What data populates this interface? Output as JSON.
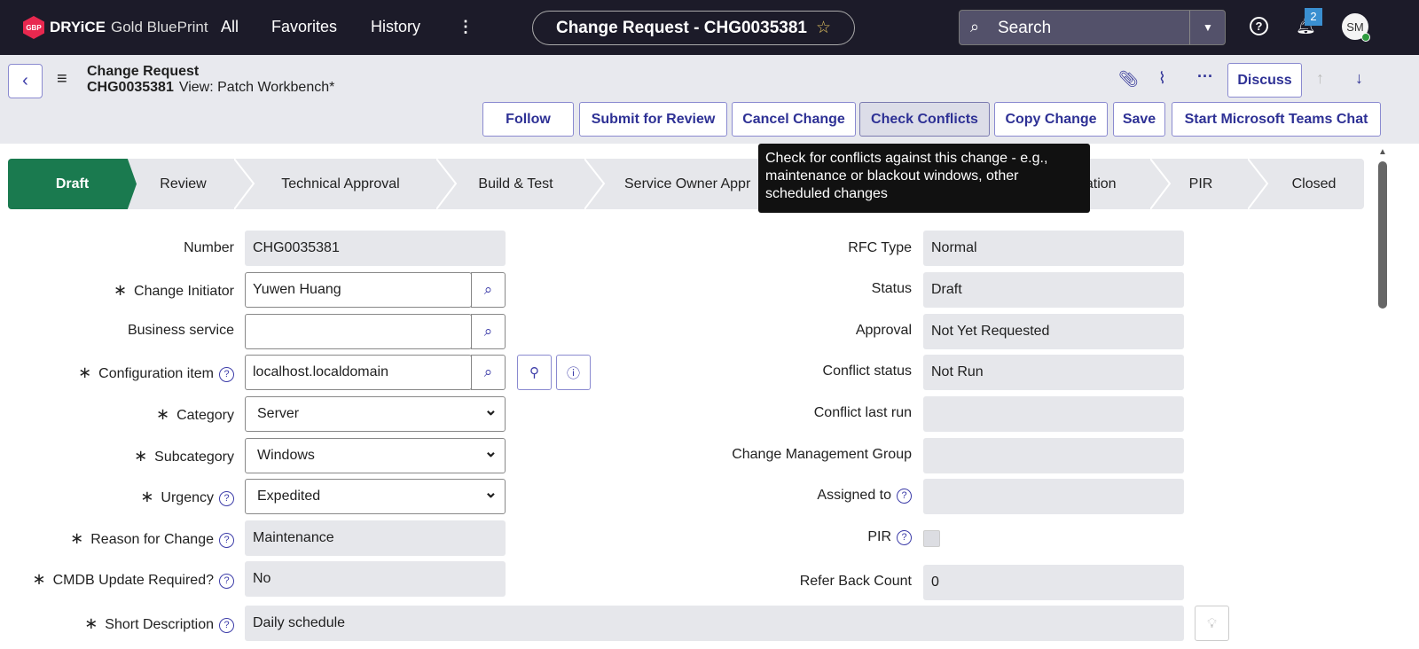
{
  "topbar": {
    "logo_mark": "GBP",
    "logo_brand": "DRYiCE",
    "logo_product": "Gold BluePrint",
    "nav": [
      "All",
      "Favorites",
      "History"
    ],
    "record_title": "Change Request - CHG0035381",
    "search_placeholder": "Search",
    "notification_count": "2",
    "avatar_initials": "SM"
  },
  "header": {
    "title": "Change Request",
    "number": "CHG0035381",
    "view": "View: Patch Workbench*",
    "discuss": "Discuss",
    "buttons": [
      "Follow",
      "Submit for Review",
      "Cancel Change",
      "Check Conflicts",
      "Copy Change",
      "Save",
      "Start Microsoft Teams Chat"
    ]
  },
  "tooltip": "Check for conflicts against this change - e.g., maintenance or blackout windows, other scheduled changes",
  "stages": [
    "Draft",
    "Review",
    "Technical Approval",
    "Build & Test",
    "Service Owner Appr",
    "tation",
    "PIR",
    "Closed"
  ],
  "left": {
    "number": {
      "label": "Number",
      "value": "CHG0035381"
    },
    "initiator": {
      "label": "Change Initiator",
      "value": "Yuwen Huang"
    },
    "business_service": {
      "label": "Business service",
      "value": ""
    },
    "ci": {
      "label": "Configuration item",
      "value": "localhost.localdomain"
    },
    "category": {
      "label": "Category",
      "value": "Server"
    },
    "subcategory": {
      "label": "Subcategory",
      "value": "Windows"
    },
    "urgency": {
      "label": "Urgency",
      "value": "Expedited"
    },
    "reason": {
      "label": "Reason for Change",
      "value": "Maintenance"
    },
    "cmdb": {
      "label": "CMDB Update Required?",
      "value": "No"
    },
    "short_desc": {
      "label": "Short Description",
      "value": "Daily schedule"
    }
  },
  "right": {
    "rfc_type": {
      "label": "RFC Type",
      "value": "Normal"
    },
    "status": {
      "label": "Status",
      "value": "Draft"
    },
    "approval": {
      "label": "Approval",
      "value": "Not Yet Requested"
    },
    "conflict_status": {
      "label": "Conflict status",
      "value": "Not Run"
    },
    "conflict_last_run": {
      "label": "Conflict last run",
      "value": ""
    },
    "cm_group": {
      "label": "Change Management Group",
      "value": ""
    },
    "assigned_to": {
      "label": "Assigned to",
      "value": ""
    },
    "pir": {
      "label": "PIR",
      "checked": false
    },
    "refer_back": {
      "label": "Refer Back Count",
      "value": "0"
    }
  }
}
